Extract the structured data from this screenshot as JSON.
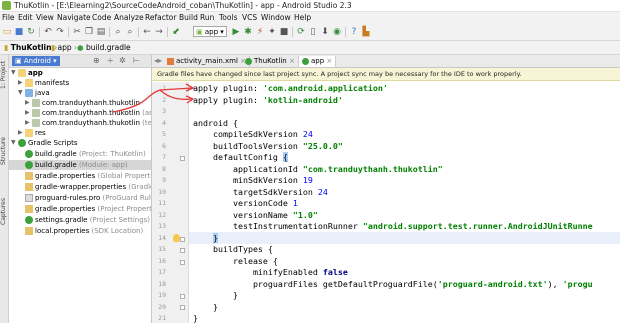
{
  "window": {
    "title": "ThuKotlin - [E:\\Elearning2\\SourceCodeAndroid_coban\\ThuKotlin] - app - Android Studio 2.3"
  },
  "menu": [
    "File",
    "Edit",
    "View",
    "Navigate",
    "Code",
    "Analyze",
    "Refactor",
    "Build",
    "Run",
    "Tools",
    "VCS",
    "Window",
    "Help"
  ],
  "toolbar": {
    "run_config": "app"
  },
  "breadcrumb": [
    "ThuKotlin",
    "app",
    "build.gradle"
  ],
  "project_panel": {
    "view_mode": "Android",
    "tree": [
      {
        "label": "app",
        "hint": "",
        "icon": "folder-icon",
        "arrow": "▼"
      },
      {
        "label": "manifests",
        "hint": "",
        "icon": "folder-icon",
        "arrow": "▶"
      },
      {
        "label": "java",
        "hint": "",
        "icon": "folder-icon",
        "arrow": "▼"
      },
      {
        "label": "com.tranduythanh.thukotlin",
        "hint": "",
        "icon": "package-icon",
        "arrow": "▶"
      },
      {
        "label": "com.tranduythanh.thukotlin",
        "hint": "(androi",
        "icon": "package-icon",
        "arrow": "▶"
      },
      {
        "label": "com.tranduythanh.thukotlin",
        "hint": "(test)",
        "icon": "package-icon",
        "arrow": "▶"
      },
      {
        "label": "res",
        "hint": "",
        "icon": "folder-icon",
        "arrow": "▶"
      },
      {
        "label": "Gradle Scripts",
        "hint": "",
        "icon": "gradle-icon",
        "arrow": "▼"
      },
      {
        "label": "build.gradle",
        "hint": "(Project: ThuKotlin)",
        "icon": "gradle-icon",
        "arrow": ""
      },
      {
        "label": "build.gradle",
        "hint": "(Module: app)",
        "icon": "gradle-icon",
        "arrow": ""
      },
      {
        "label": "gradle.properties",
        "hint": "(Global Properties)",
        "icon": "properties-icon",
        "arrow": ""
      },
      {
        "label": "gradle-wrapper.properties",
        "hint": "(Gradle Versio",
        "icon": "properties-icon",
        "arrow": ""
      },
      {
        "label": "proguard-rules.pro",
        "hint": "(ProGuard Rules for ap",
        "icon": "text-file-icon",
        "arrow": ""
      },
      {
        "label": "gradle.properties",
        "hint": "(Project Properties)",
        "icon": "properties-icon",
        "arrow": ""
      },
      {
        "label": "settings.gradle",
        "hint": "(Project Settings)",
        "icon": "gradle-icon",
        "arrow": ""
      },
      {
        "label": "local.properties",
        "hint": "(SDK Location)",
        "icon": "properties-icon",
        "arrow": ""
      }
    ]
  },
  "editor_tabs": [
    "activity_main.xml",
    "ThuKotlin",
    "app"
  ],
  "notice": "Gradle files have changed since last project sync. A project sync may be necessary for the IDE to work properly.",
  "line_numbers": [
    "1",
    "2",
    "3",
    "4",
    "5",
    "6",
    "7",
    "8",
    "9",
    "10",
    "11",
    "12",
    "13",
    "14",
    "15",
    "16",
    "17",
    "18",
    "19",
    "20",
    "21"
  ],
  "code": {
    "l1": [
      "apply plugin: ",
      "'com.android.application'"
    ],
    "l2": [
      "apply plugin: ",
      "'kotlin-android'"
    ],
    "l4": "android {",
    "l5": [
      "    compileSdkVersion ",
      "24"
    ],
    "l6": [
      "    buildToolsVersion ",
      "\"25.0.0\""
    ],
    "l7": [
      "    defaultConfig ",
      "{"
    ],
    "l8": [
      "        applicationId ",
      "\"com.tranduythanh.thukotlin\""
    ],
    "l9": [
      "        minSdkVersion ",
      "19"
    ],
    "l10": [
      "        targetSdkVersion ",
      "24"
    ],
    "l11": [
      "        versionCode ",
      "1"
    ],
    "l12": [
      "        versionName ",
      "\"1.0\""
    ],
    "l13": [
      "        testInstrumentationRunner ",
      "\"android.support.test.runner.AndroidJUnitRunne"
    ],
    "l14": [
      "    ",
      "}"
    ],
    "l15": "    buildTypes {",
    "l16": "        release {",
    "l17": [
      "            minifyEnabled ",
      "false"
    ],
    "l18": [
      "            proguardFiles getDefaultProguardFile(",
      "'proguard-android.txt'",
      "), ",
      "'progu"
    ],
    "l19": "        }",
    "l20": "    }",
    "l21": "}"
  },
  "colors": {
    "keyword": "#000080",
    "string": "#008000",
    "number": "#0000ff",
    "annotation_arrow": "#e53935"
  }
}
